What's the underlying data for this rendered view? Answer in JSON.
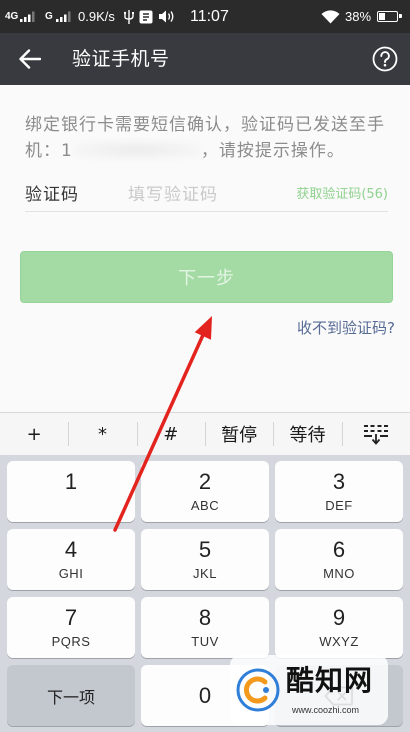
{
  "status_bar": {
    "network_primary": "4G",
    "network_secondary": "G",
    "net_speed": "0.9K/s",
    "time": "11:07",
    "battery_percent": "38%",
    "battery_level": 0.38,
    "icons": [
      "signal-icon",
      "usb-icon",
      "notification-icon",
      "volume-icon",
      "wifi-icon",
      "battery-icon"
    ]
  },
  "app_bar": {
    "title": "验证手机号",
    "back_icon": "back-arrow-icon",
    "help_icon": "help-circle-icon"
  },
  "description": {
    "line_1": "绑定银行卡需要短信确认，验证码已发送至手",
    "line_2_prefix": "机：1",
    "line_2_suffix": "，请按提示操作。"
  },
  "code_field": {
    "label": "验证码",
    "placeholder": "填写验证码",
    "get_code_label": "获取验证码(56)"
  },
  "next_button": {
    "label": "下一步",
    "enabled": false
  },
  "no_code_link": {
    "label": "收不到验证码?"
  },
  "keyboard": {
    "top_row": [
      "+",
      "*",
      "#",
      "暂停",
      "等待"
    ],
    "collapse_icon": "keyboard-collapse-icon",
    "keys": [
      {
        "digit": "1"
      },
      {
        "digit": "2",
        "letters": "ABC"
      },
      {
        "digit": "3",
        "letters": "DEF"
      },
      {
        "digit": "4",
        "letters": "GHI"
      },
      {
        "digit": "5",
        "letters": "JKL"
      },
      {
        "digit": "6",
        "letters": "MNO"
      },
      {
        "digit": "7",
        "letters": "PQRS"
      },
      {
        "digit": "8",
        "letters": "TUV"
      },
      {
        "digit": "9",
        "letters": "WXYZ"
      }
    ],
    "next_field_label": "下一项",
    "zero": "0",
    "delete_icon": "backspace-icon"
  },
  "annotation": {
    "color": "#e3231e"
  },
  "watermark": {
    "brand": "酷知网",
    "url": "www.coozhi.com",
    "logo_icon": "coozhi-logo-icon"
  },
  "colors": {
    "status_bar": "#2b2b2b",
    "title_bar": "#393a3f",
    "background": "#fafafa",
    "button_disabled_green": "#a4dba5",
    "get_code_green": "#8fd18f",
    "link_blue": "#576b95",
    "keypad_background": "#d4d7dd"
  }
}
